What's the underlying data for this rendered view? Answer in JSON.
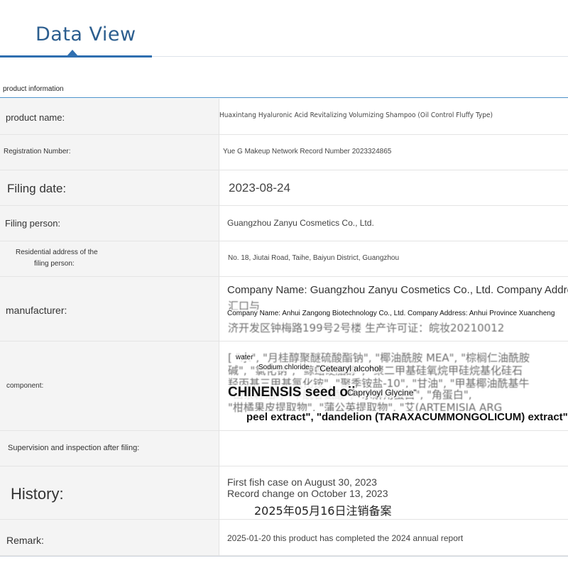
{
  "page": {
    "title": "Data View",
    "section_title": "product information"
  },
  "rows": {
    "product_name": {
      "label": "product name:",
      "value": "Huaxintang Hyaluronic Acid Revitalizing Volumizing Shampoo (Oil Control Fluffy Type)"
    },
    "registration_number": {
      "label": "Registration Number:",
      "value": "Yue G Makeup Network Record Number 2023324865"
    },
    "filing_date": {
      "label": "Filing date:",
      "value": "2023-08-24"
    },
    "filing_person": {
      "label": "Filing person:",
      "value": "Guangzhou Zanyu Cosmetics Co., Ltd."
    },
    "residential_address": {
      "label_line1": "Residential address of the",
      "label_line2": "filing person:",
      "value": "No. 18, Jiutai Road, Taihe, Baiyun District, Guangzhou"
    },
    "manufacturer": {
      "label": "manufacturer:",
      "line1": "Company Name: Guangzhou Zanyu Cosmetics Co., Ltd. Company Address:",
      "line2_garbled": "汇口与",
      "overlay": "Company Name: Anhui Zangong Biotechnology Co., Ltd. Company Address: Anhui Province Xuancheng",
      "line3": "济开发区钟梅路199号2号楼 生产许可证：皖妆20210012"
    },
    "component": {
      "label": "component:",
      "line1": "[ \"水\", \"月桂醇聚醚硫酸酯钠\", \"椰油酰胺 MEA\", \"棕榈仁油酰胺",
      "line2": "碱\", \"氯化钠\", \"鲸蜡硬脂醇\", \"聚二甲基硅氧烷甲硅烷基化硅石",
      "line3": "羟丙基三甲基氯化铵\", \"聚季铵盐-10\", \"甘油\", \"甲基椰油酰基牛",
      "line4": "\"山茶籽油\", \"辛酰甘氨酸\", \"水解角蛋白\", \"角蛋白\",",
      "line5": "\"柑橘果皮提取物\", \"蒲公英提取物\", \"艾(ARTEMISIA ARG",
      "ov_water": "water",
      "ov_sodium": "Sodium chloride",
      "ov_cetearyl": "\"Cetearyl alcohol",
      "ov_chinensis": "CHINENSIS seed oil",
      "ov_capryloyl": "Capryloyl Glycine\"",
      "ov_peel": "peel extract\", \"dandelion (TARAXACUMMONGOLICUM) extract\""
    },
    "supervision": {
      "label": "Supervision and inspection after filing:",
      "value": ""
    },
    "history": {
      "label": "History:",
      "line1": "First fish case on August 30, 2023",
      "line2": "Record change on October 13, 2023",
      "line3": "2025年05月16日注销备案"
    },
    "remark": {
      "label": "Remark:",
      "value": "2025-01-20 this product has completed the 2024 annual report"
    }
  }
}
